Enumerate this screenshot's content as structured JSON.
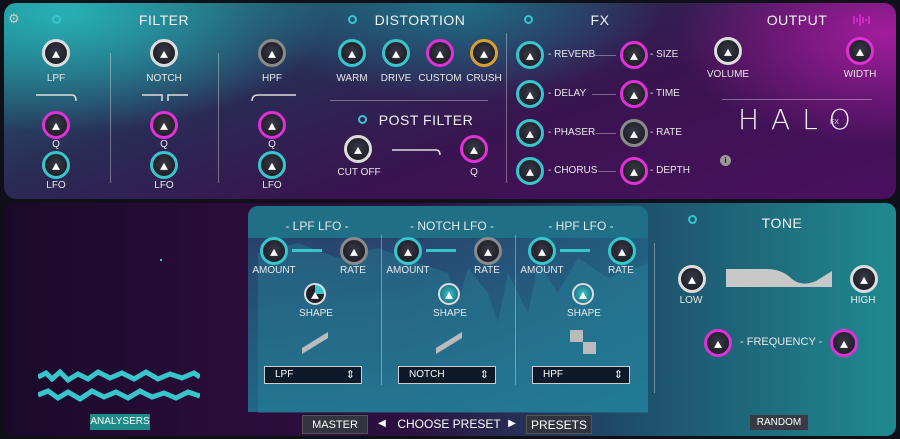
{
  "filter": {
    "title": "FILTER",
    "lpf": "LPF",
    "notch": "NOTCH",
    "hpf": "HPF",
    "q": "Q",
    "lfo": "LFO"
  },
  "distortion": {
    "title": "DISTORTION",
    "warm": "WARM",
    "drive": "DRIVE",
    "custom": "CUSTOM",
    "crush": "CRUSH"
  },
  "post_filter": {
    "title": "POST FILTER",
    "cutoff": "CUT OFF",
    "q": "Q"
  },
  "fx": {
    "title": "FX",
    "reverb": "- REVERB",
    "delay": "- DELAY",
    "phaser": "- PHASER",
    "chorus": "- CHORUS",
    "size": "- SIZE",
    "time": "- TIME",
    "rate": "- RATE",
    "depth": "- DEPTH"
  },
  "output": {
    "title": "OUTPUT",
    "volume": "VOLUME",
    "width": "WIDTH",
    "logo": "HALO",
    "logo_sub": "FX",
    "info": "i"
  },
  "lfo": {
    "lpf_title": "- LPF LFO -",
    "notch_title": "- NOTCH LFO -",
    "hpf_title": "- HPF LFO -",
    "amount": "AMOUNT",
    "rate": "RATE",
    "shape": "SHAPE",
    "lpf_select": "LPF",
    "notch_select": "NOTCH",
    "hpf_select": "HPF"
  },
  "tone": {
    "title": "TONE",
    "low": "LOW",
    "high": "HIGH",
    "frequency": "- FREQUENCY -",
    "random": "RANDOM"
  },
  "bottom": {
    "analysers": "ANALYSERS",
    "master_eq": "MASTER EQ",
    "prev": "◀",
    "choose_preset": "CHOOSE PRESET",
    "next": "▶",
    "presets": "PRESETS"
  },
  "colors": {
    "cyan": "#36c6cc",
    "magenta": "#e030d8"
  }
}
